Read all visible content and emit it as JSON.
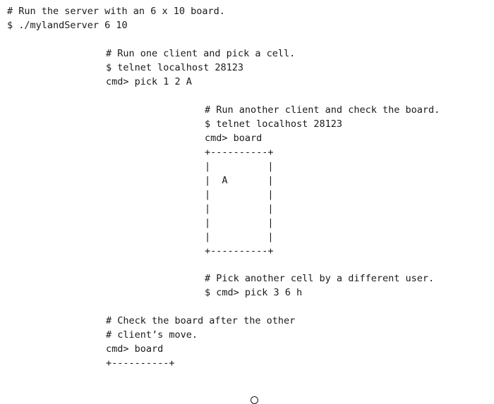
{
  "server_session": {
    "lines": [
      "# Run the server with an 6 x 10 board.",
      "$ ./mylandServer 6 10"
    ]
  },
  "client1_session": {
    "lines": [
      "# Run one client and pick a cell.",
      "$ telnet localhost 28123",
      "cmd> pick 1 2 A"
    ]
  },
  "client2_session": {
    "lines": [
      "# Run another client and check the board.",
      "$ telnet localhost 28123",
      "cmd> board",
      "+----------+",
      "|          |",
      "|  A       |",
      "|          |",
      "|          |",
      "|          |",
      "|          |",
      "+----------+"
    ]
  },
  "pick2_session": {
    "lines": [
      "# Pick another cell by a different user.",
      "$ cmd> pick 3 6 h"
    ]
  },
  "check_session": {
    "lines": [
      "# Check the board after the other",
      "# client’s move.",
      "cmd> board",
      "+----------+"
    ]
  }
}
